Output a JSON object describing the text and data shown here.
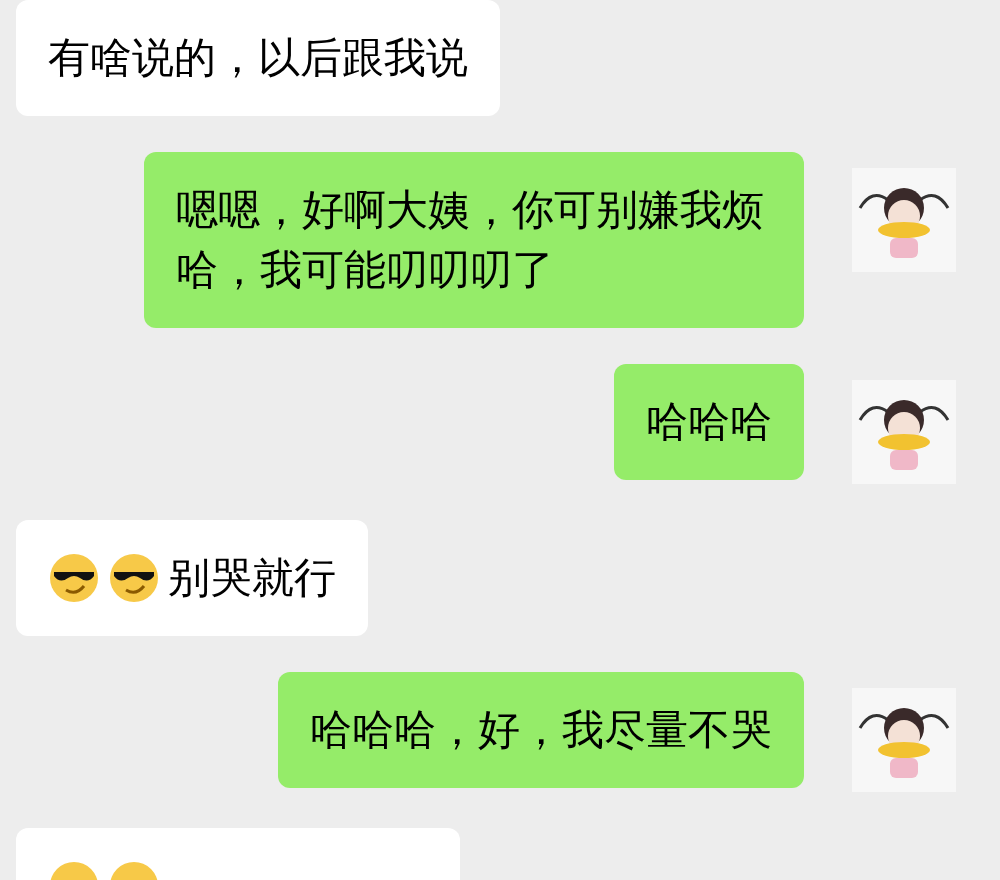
{
  "messages": [
    {
      "outgoing": false,
      "kind": "text",
      "text": "有啥说的，以后跟我说"
    },
    {
      "outgoing": true,
      "kind": "text",
      "text": "嗯嗯，好啊大姨，你可别嫌我烦哈，我可能叨叨叨了"
    },
    {
      "outgoing": true,
      "kind": "text",
      "text": "哈哈哈"
    },
    {
      "outgoing": false,
      "kind": "emoji_text",
      "text": "别哭就行"
    },
    {
      "outgoing": true,
      "kind": "text",
      "text": "哈哈哈，好，我尽量不哭"
    },
    {
      "outgoing": false,
      "kind": "emoji_cut"
    }
  ]
}
